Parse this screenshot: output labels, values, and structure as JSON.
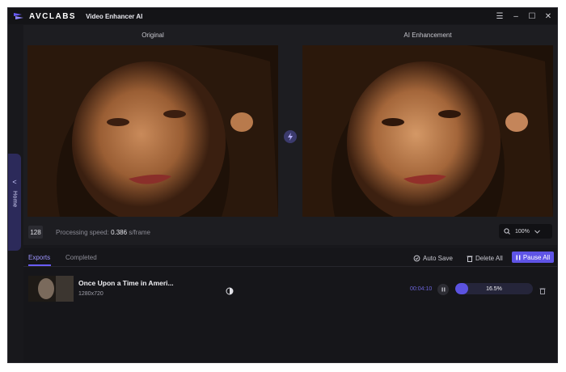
{
  "titlebar": {
    "brand": "AVCLABS",
    "app_name": "Video Enhancer AI",
    "controls": [
      "☰",
      "–",
      "☐",
      "✕"
    ]
  },
  "sidebar": {
    "tab_label": "Home",
    "chevron": "<"
  },
  "preview": {
    "original_label": "Original",
    "enhanced_label": "AI Enhancement",
    "frame_count": "128",
    "speed_label": "Processing speed:",
    "speed_value": "0.386",
    "speed_unit": "s/frame",
    "zoom_level": "100%"
  },
  "queue": {
    "tabs": [
      "Exports",
      "Completed"
    ],
    "auto_save_label": "Auto Save",
    "delete_all_label": "Delete All",
    "pause_all_label": "Pause All",
    "items": [
      {
        "name": "Once Upon a Time in Ameri...",
        "resolution": "1280x720",
        "elapsed": "00:04:10",
        "progress_text": "16.5%",
        "progress": 16.5
      }
    ]
  },
  "colors": {
    "accent": "#5f54e6",
    "background": "#18181c"
  }
}
